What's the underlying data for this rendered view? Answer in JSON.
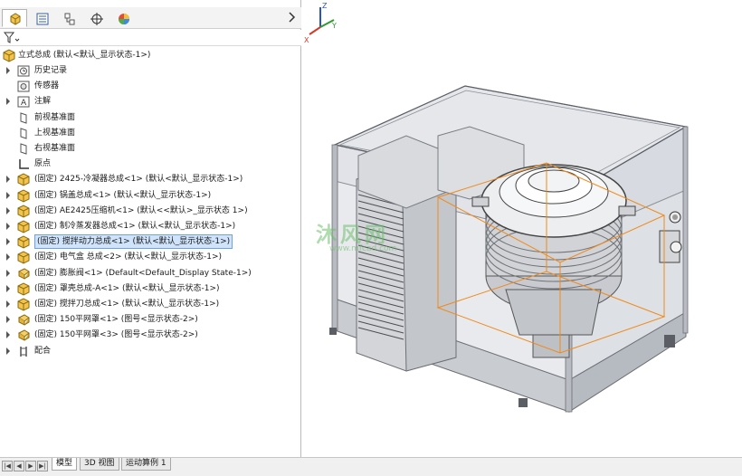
{
  "tree": {
    "root_label": "立式总成  (默认<默认_显示状态-1>)",
    "items": [
      {
        "label": "历史记录",
        "expander": true,
        "icon": "history-icon"
      },
      {
        "label": "传感器",
        "expander": false,
        "icon": "sensor-icon"
      },
      {
        "label": "注解",
        "expander": true,
        "icon": "annotation-icon"
      },
      {
        "label": "前视基准面",
        "expander": false,
        "icon": "plane-icon"
      },
      {
        "label": "上视基准面",
        "expander": false,
        "icon": "plane-icon"
      },
      {
        "label": "右视基准面",
        "expander": false,
        "icon": "plane-icon"
      },
      {
        "label": "原点",
        "expander": false,
        "icon": "origin-icon"
      },
      {
        "label": "(固定) 2425-冷凝器总成<1> (默认<默认_显示状态-1>)",
        "expander": true,
        "icon": "subassembly-icon"
      },
      {
        "label": "(固定) 锅盖总成<1> (默认<默认_显示状态-1>)",
        "expander": true,
        "icon": "subassembly-icon"
      },
      {
        "label": "(固定) AE2425压缩机<1> (默认<<默认>_显示状态 1>)",
        "expander": true,
        "icon": "subassembly-icon"
      },
      {
        "label": "(固定) 制冷蒸发器总成<1> (默认<默认_显示状态-1>)",
        "expander": true,
        "icon": "subassembly-icon"
      },
      {
        "label": "(固定) 搅拌动力总成<1> (默认<默认_显示状态-1>)",
        "expander": true,
        "icon": "subassembly-icon",
        "selected": true
      },
      {
        "label": "(固定) 电气盒 总成<2> (默认<默认_显示状态-1>)",
        "expander": true,
        "icon": "subassembly-icon"
      },
      {
        "label": "(固定) 膨胀阀<1> (Default<Default_Display State-1>)",
        "expander": true,
        "icon": "part-icon"
      },
      {
        "label": "(固定) 罩壳总成-A<1> (默认<默认_显示状态-1>)",
        "expander": true,
        "icon": "subassembly-icon"
      },
      {
        "label": "(固定) 搅拌刀总成<1> (默认<默认_显示状态-1>)",
        "expander": true,
        "icon": "subassembly-icon"
      },
      {
        "label": "(固定) 150平网罩<1> (图号<显示状态-2>)",
        "expander": true,
        "icon": "part-icon"
      },
      {
        "label": "(固定) 150平网罩<3> (图号<显示状态-2>)",
        "expander": true,
        "icon": "part-icon"
      },
      {
        "label": "配合",
        "expander": true,
        "icon": "mates-icon"
      }
    ]
  },
  "panel_tabs": [
    {
      "name": "feature-manager-tab",
      "icon": "assembly-icon"
    },
    {
      "name": "property-manager-tab",
      "icon": "property-icon"
    },
    {
      "name": "configuration-manager-tab",
      "icon": "configuration-icon"
    },
    {
      "name": "dimxpert-tab",
      "icon": "crosshair-icon"
    },
    {
      "name": "display-manager-tab",
      "icon": "appearance-icon"
    }
  ],
  "bottom_tabs": {
    "model": "模型",
    "view3d": "3D 视图",
    "motion": "运动算例 1"
  },
  "viewport": {
    "watermark": "沐风网",
    "watermark_url": "www.mfcad.com",
    "triad": {
      "x": "X",
      "y": "Y",
      "z": "Z"
    }
  },
  "colors": {
    "selection_bg": "#cfe3fb",
    "selection_border": "#6ea1e5",
    "highlight_orange": "#f08a1c",
    "triad_x": "#d23b2a",
    "triad_y": "#2f9a2f",
    "triad_z": "#2a52c8"
  }
}
